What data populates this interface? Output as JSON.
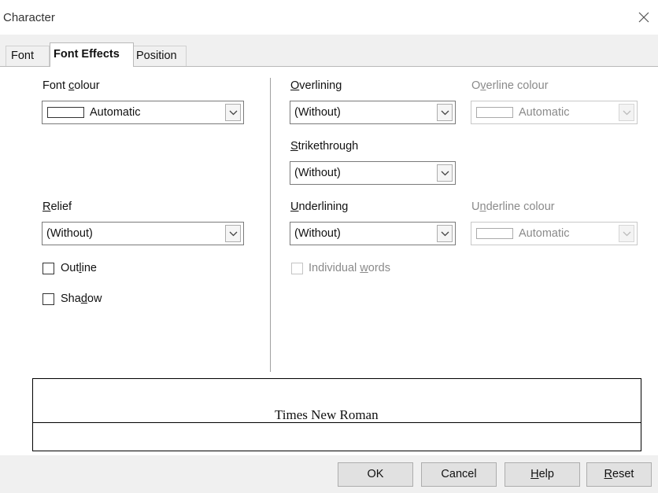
{
  "window": {
    "title": "Character",
    "close_icon": "close-icon"
  },
  "tabs": [
    {
      "label": "Font"
    },
    {
      "label": "Font Effects",
      "selected": true
    },
    {
      "label": "Position"
    }
  ],
  "font_colour": {
    "label_pre": "Font ",
    "label_u": "c",
    "label_post": "olour",
    "value": "Automatic"
  },
  "relief": {
    "label_u": "R",
    "label_post": "elief",
    "value": "(Without)"
  },
  "outline": {
    "label_pre": "Out",
    "label_u": "l",
    "label_post": "ine",
    "checked": false
  },
  "shadow": {
    "label_pre": "Sha",
    "label_u": "d",
    "label_post": "ow",
    "checked": false
  },
  "overlining": {
    "label_u": "O",
    "label_post": "verlining",
    "value": "(Without)"
  },
  "overline_colour": {
    "label_pre": "O",
    "label_u": "v",
    "label_post": "erline colour",
    "value": "Automatic",
    "enabled": false
  },
  "strikethrough": {
    "label_u": "S",
    "label_post": "trikethrough",
    "value": "(Without)"
  },
  "underlining": {
    "label_u": "U",
    "label_post": "nderlining",
    "value": "(Without)"
  },
  "underline_colour": {
    "label_pre": "U",
    "label_u": "n",
    "label_post": "derline colour",
    "value": "Automatic",
    "enabled": false
  },
  "individual_words": {
    "label_pre": "Individual ",
    "label_u": "w",
    "label_post": "ords",
    "enabled": false,
    "checked": false
  },
  "preview": {
    "sample_text": "Times New Roman"
  },
  "buttons": {
    "ok": "OK",
    "cancel": "Cancel",
    "help_u": "H",
    "help_post": "elp",
    "reset_u": "R",
    "reset_post": "eset"
  },
  "colors": {
    "dialog_bg": "#f0f0f0",
    "panel_bg": "#ffffff",
    "disabled_text": "#8a8a8a"
  }
}
